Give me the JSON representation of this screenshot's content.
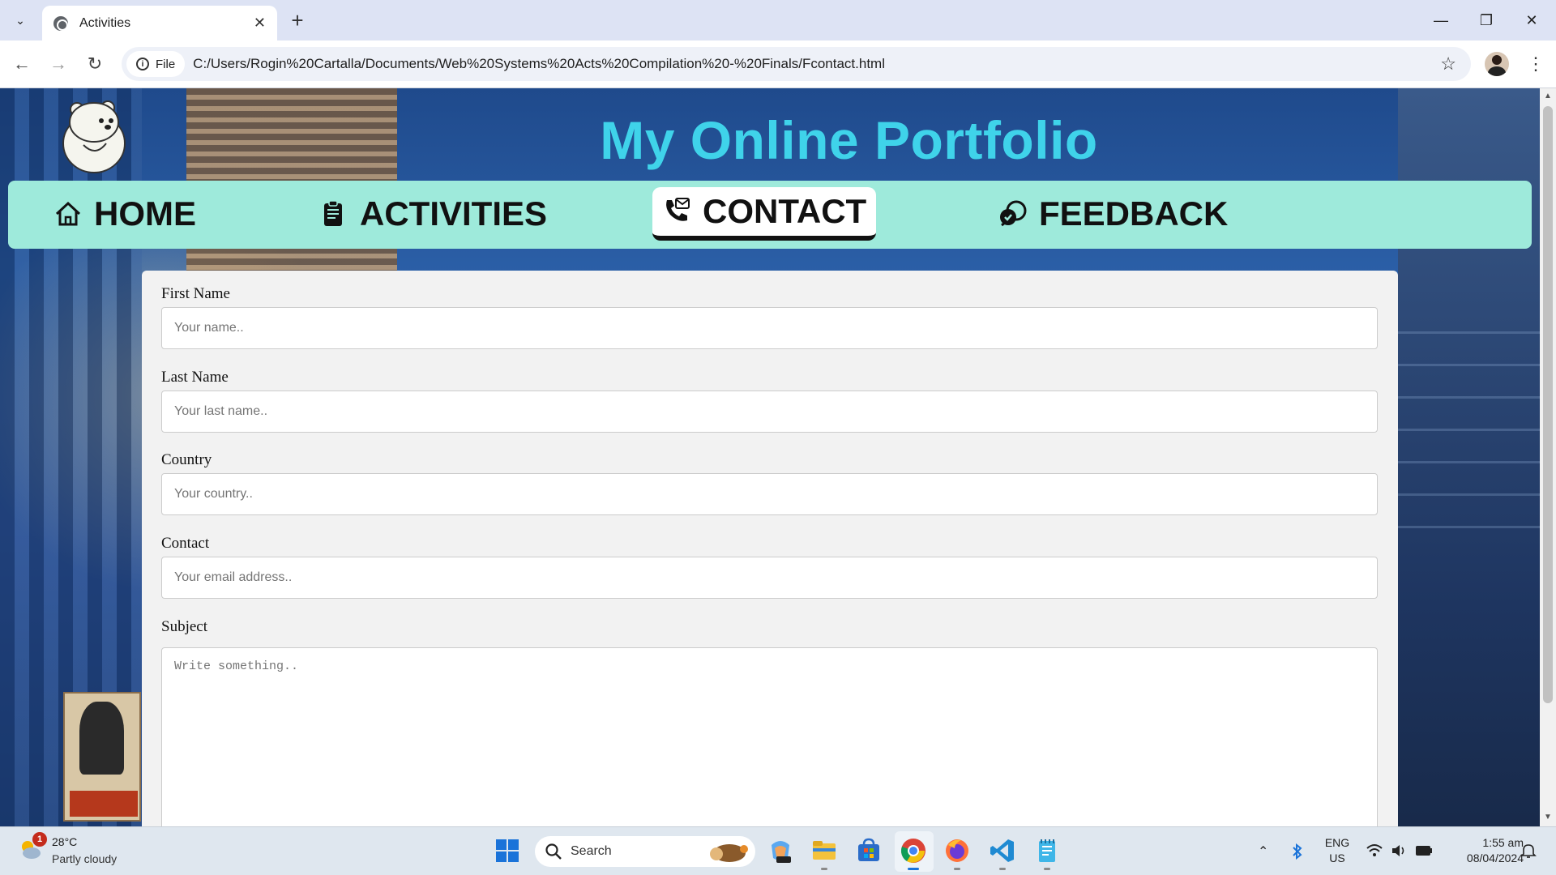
{
  "browser": {
    "tab_title": "Activities",
    "url_chip": "File",
    "url": "C:/Users/Rogin%20Cartalla/Documents/Web%20Systems%20Acts%20Compilation%20-%20Finals/Fcontact.html"
  },
  "site": {
    "title": "My Online Portfolio",
    "nav": [
      {
        "label": "HOME",
        "icon": "home-icon",
        "active": false
      },
      {
        "label": "ACTIVITIES",
        "icon": "clipboard-icon",
        "active": false
      },
      {
        "label": "CONTACT",
        "icon": "phone-mail-icon",
        "active": true
      },
      {
        "label": "FEEDBACK",
        "icon": "feedback-icon",
        "active": false
      }
    ]
  },
  "form": {
    "first_name": {
      "label": "First Name",
      "placeholder": "Your name.."
    },
    "last_name": {
      "label": "Last Name",
      "placeholder": "Your last name.."
    },
    "country": {
      "label": "Country",
      "placeholder": "Your country.."
    },
    "contact": {
      "label": "Contact",
      "placeholder": "Your email address.."
    },
    "subject": {
      "label": "Subject",
      "placeholder": "Write something.."
    }
  },
  "taskbar": {
    "weather_badge": "1",
    "temperature": "28°C",
    "weather": "Partly cloudy",
    "search_placeholder": "Search",
    "lang_line1": "ENG",
    "lang_line2": "US",
    "time": "1:55 am",
    "date": "08/04/2024"
  },
  "colors": {
    "title": "#3fd3ea",
    "navbar": "#9eeadb",
    "card": "#f2f2f2"
  }
}
